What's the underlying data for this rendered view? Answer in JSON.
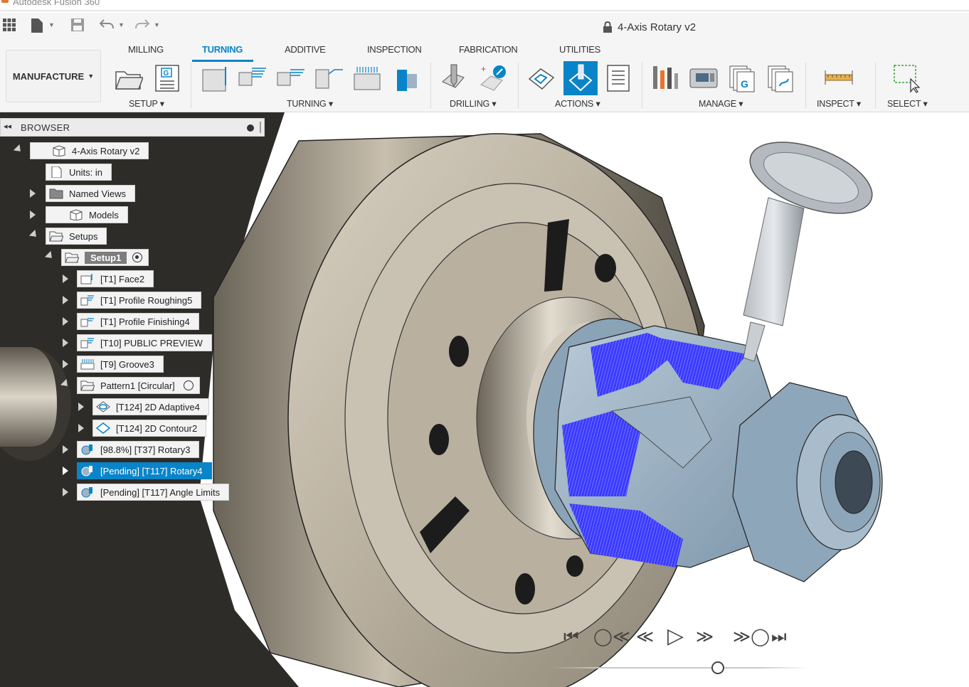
{
  "app": {
    "window_title": "Autodesk Fusion 360",
    "document_title": "4-Axis Rotary v2"
  },
  "ribbon": {
    "workspace": "MANUFACTURE",
    "tabs": [
      {
        "label": "MILLING"
      },
      {
        "label": "TURNING"
      },
      {
        "label": "ADDITIVE"
      },
      {
        "label": "INSPECTION"
      },
      {
        "label": "FABRICATION"
      },
      {
        "label": "UTILITIES"
      }
    ],
    "active_tab": "TURNING",
    "groups": {
      "setup": "SETUP",
      "turning": "TURNING",
      "drilling": "DRILLING",
      "actions": "ACTIONS",
      "manage": "MANAGE",
      "inspect": "INSPECT",
      "select": "SELECT"
    },
    "accent_color": "#0a84c8"
  },
  "browser": {
    "title": "BROWSER",
    "items": [
      {
        "label": "4-Axis Rotary v2",
        "icon": "component-icon"
      },
      {
        "label": "Units: in",
        "icon": "document-icon"
      },
      {
        "label": "Named Views",
        "icon": "folder-icon"
      },
      {
        "label": "Models",
        "icon": "component-icon"
      },
      {
        "label": "Setups",
        "icon": "folder-open-icon"
      },
      {
        "label": "Setup1",
        "icon": "setup-icon"
      },
      {
        "label": "[T1] Face2",
        "icon": "turning-face-icon"
      },
      {
        "label": "[T1] Profile Roughing5",
        "icon": "turning-profile-icon"
      },
      {
        "label": "[T1] Profile Finishing4",
        "icon": "turning-profile-icon"
      },
      {
        "label": "[T10] PUBLIC PREVIEW",
        "icon": "turning-profile-icon"
      },
      {
        "label": "[T9] Groove3",
        "icon": "turning-groove-icon"
      },
      {
        "label": "Pattern1 [Circular]",
        "icon": "pattern-icon"
      },
      {
        "label": "[T124] 2D Adaptive4",
        "icon": "adaptive-icon"
      },
      {
        "label": "[T124] 2D Contour2",
        "icon": "contour-icon"
      },
      {
        "label": "[98.8%] [T37] Rotary3",
        "icon": "rotary-icon"
      },
      {
        "label": "[Pending] [T117] Rotary4",
        "icon": "rotary-icon"
      },
      {
        "label": "[Pending] [T117] Angle Limits",
        "icon": "rotary-icon"
      }
    ],
    "selected_item": "[Pending] [T117] Rotary4"
  },
  "colors": {
    "toolpath": "#2222ff",
    "part": "#9eb3c4",
    "chuck": "#8e8577",
    "selection": "#0a84c8"
  }
}
